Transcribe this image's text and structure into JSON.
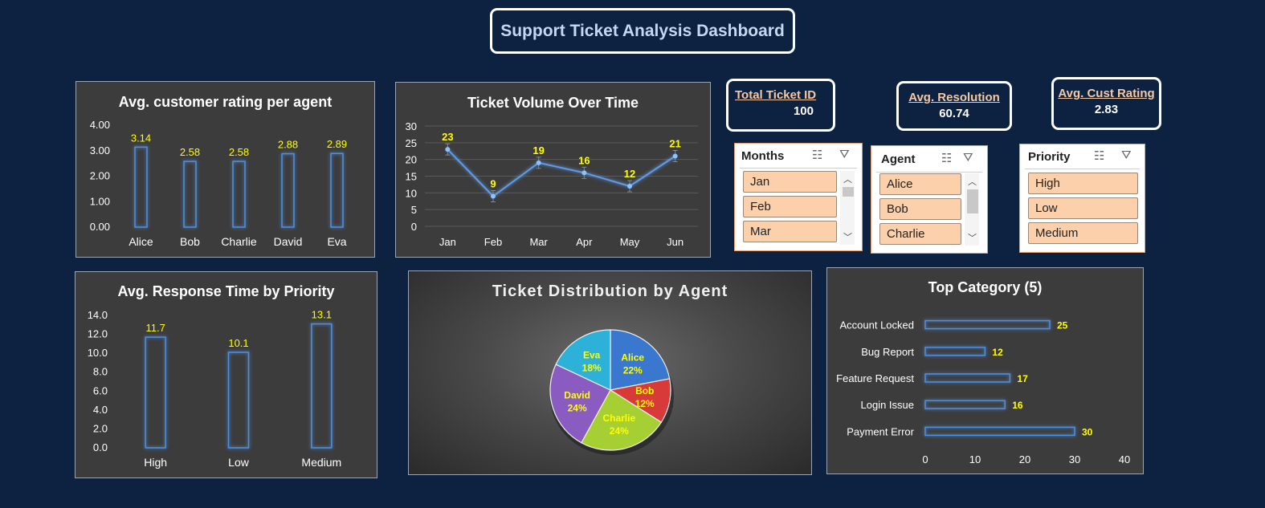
{
  "dashboard_title": "Support Ticket Analysis Dashboard",
  "kpis": [
    {
      "label": "Total Ticket ID",
      "value": "100"
    },
    {
      "label": "Avg. Resolution",
      "value": "60.74"
    },
    {
      "label": "Avg. Cust Rating",
      "value": "2.83"
    }
  ],
  "slicers": {
    "months": {
      "header": "Months",
      "items": [
        "Jan",
        "Feb",
        "Mar"
      ]
    },
    "agent": {
      "header": "Agent",
      "items": [
        "Alice",
        "Bob",
        "Charlie"
      ]
    },
    "priority": {
      "header": "Priority",
      "items": [
        "High",
        "Low",
        "Medium"
      ]
    }
  },
  "icons": {
    "multi_select": "multi-select-icon",
    "clear_filter": "clear-filter-icon",
    "scroll_up": "chevron-up-icon",
    "scroll_down": "chevron-down-icon"
  },
  "colors": {
    "background": "#0d2240",
    "panel": "#3c3c3c",
    "bar_outline": "#4f8fe0",
    "data_label": "#ffff00",
    "slicer_item": "#fbd0ab"
  },
  "chart_data": [
    {
      "type": "bar",
      "title": "Avg. customer rating per agent",
      "categories": [
        "Alice",
        "Bob",
        "Charlie",
        "David",
        "Eva"
      ],
      "values": [
        3.14,
        2.58,
        2.58,
        2.88,
        2.89
      ],
      "data_labels": [
        "3.14",
        "2.58",
        "2.58",
        "2.88",
        "2.89"
      ],
      "ylim": [
        0,
        4
      ],
      "yticks": [
        "0.00",
        "1.00",
        "2.00",
        "3.00",
        "4.00"
      ]
    },
    {
      "type": "line",
      "title": "Ticket Volume Over Time",
      "categories": [
        "Jan",
        "Feb",
        "Mar",
        "Apr",
        "May",
        "Jun"
      ],
      "values": [
        23,
        9,
        19,
        16,
        12,
        21
      ],
      "data_labels": [
        "23",
        "9",
        "19",
        "16",
        "12",
        "21"
      ],
      "ylim": [
        0,
        30
      ],
      "yticks": [
        "0",
        "5",
        "10",
        "15",
        "20",
        "25",
        "30"
      ],
      "grid": true
    },
    {
      "type": "bar",
      "title": "Avg. Response Time by Priority",
      "categories": [
        "High",
        "Low",
        "Medium"
      ],
      "values": [
        11.7,
        10.1,
        13.1
      ],
      "data_labels": [
        "11.7",
        "10.1",
        "13.1"
      ],
      "ylim": [
        0,
        14
      ],
      "yticks": [
        "0.0",
        "2.0",
        "4.0",
        "6.0",
        "8.0",
        "10.0",
        "12.0",
        "14.0"
      ]
    },
    {
      "type": "pie",
      "title": "Ticket Distribution by Agent",
      "categories": [
        "Alice",
        "Bob",
        "Charlie",
        "David",
        "Eva"
      ],
      "values": [
        22,
        12,
        24,
        24,
        18
      ],
      "data_labels": [
        "22%",
        "12%",
        "24%",
        "24%",
        "18%"
      ],
      "colors": [
        "#3a78d0",
        "#d83a3a",
        "#a6cf34",
        "#8a5bc0",
        "#2eb1d8"
      ]
    },
    {
      "type": "bar",
      "orientation": "horizontal",
      "title": "Top Category (5)",
      "categories": [
        "Account Locked",
        "Bug Report",
        "Feature Request",
        "Login Issue",
        "Payment Error"
      ],
      "values": [
        25,
        12,
        17,
        16,
        30
      ],
      "data_labels": [
        "25",
        "12",
        "17",
        "16",
        "30"
      ],
      "xlim": [
        0,
        40
      ],
      "xticks": [
        "0",
        "10",
        "20",
        "30",
        "40"
      ]
    }
  ]
}
